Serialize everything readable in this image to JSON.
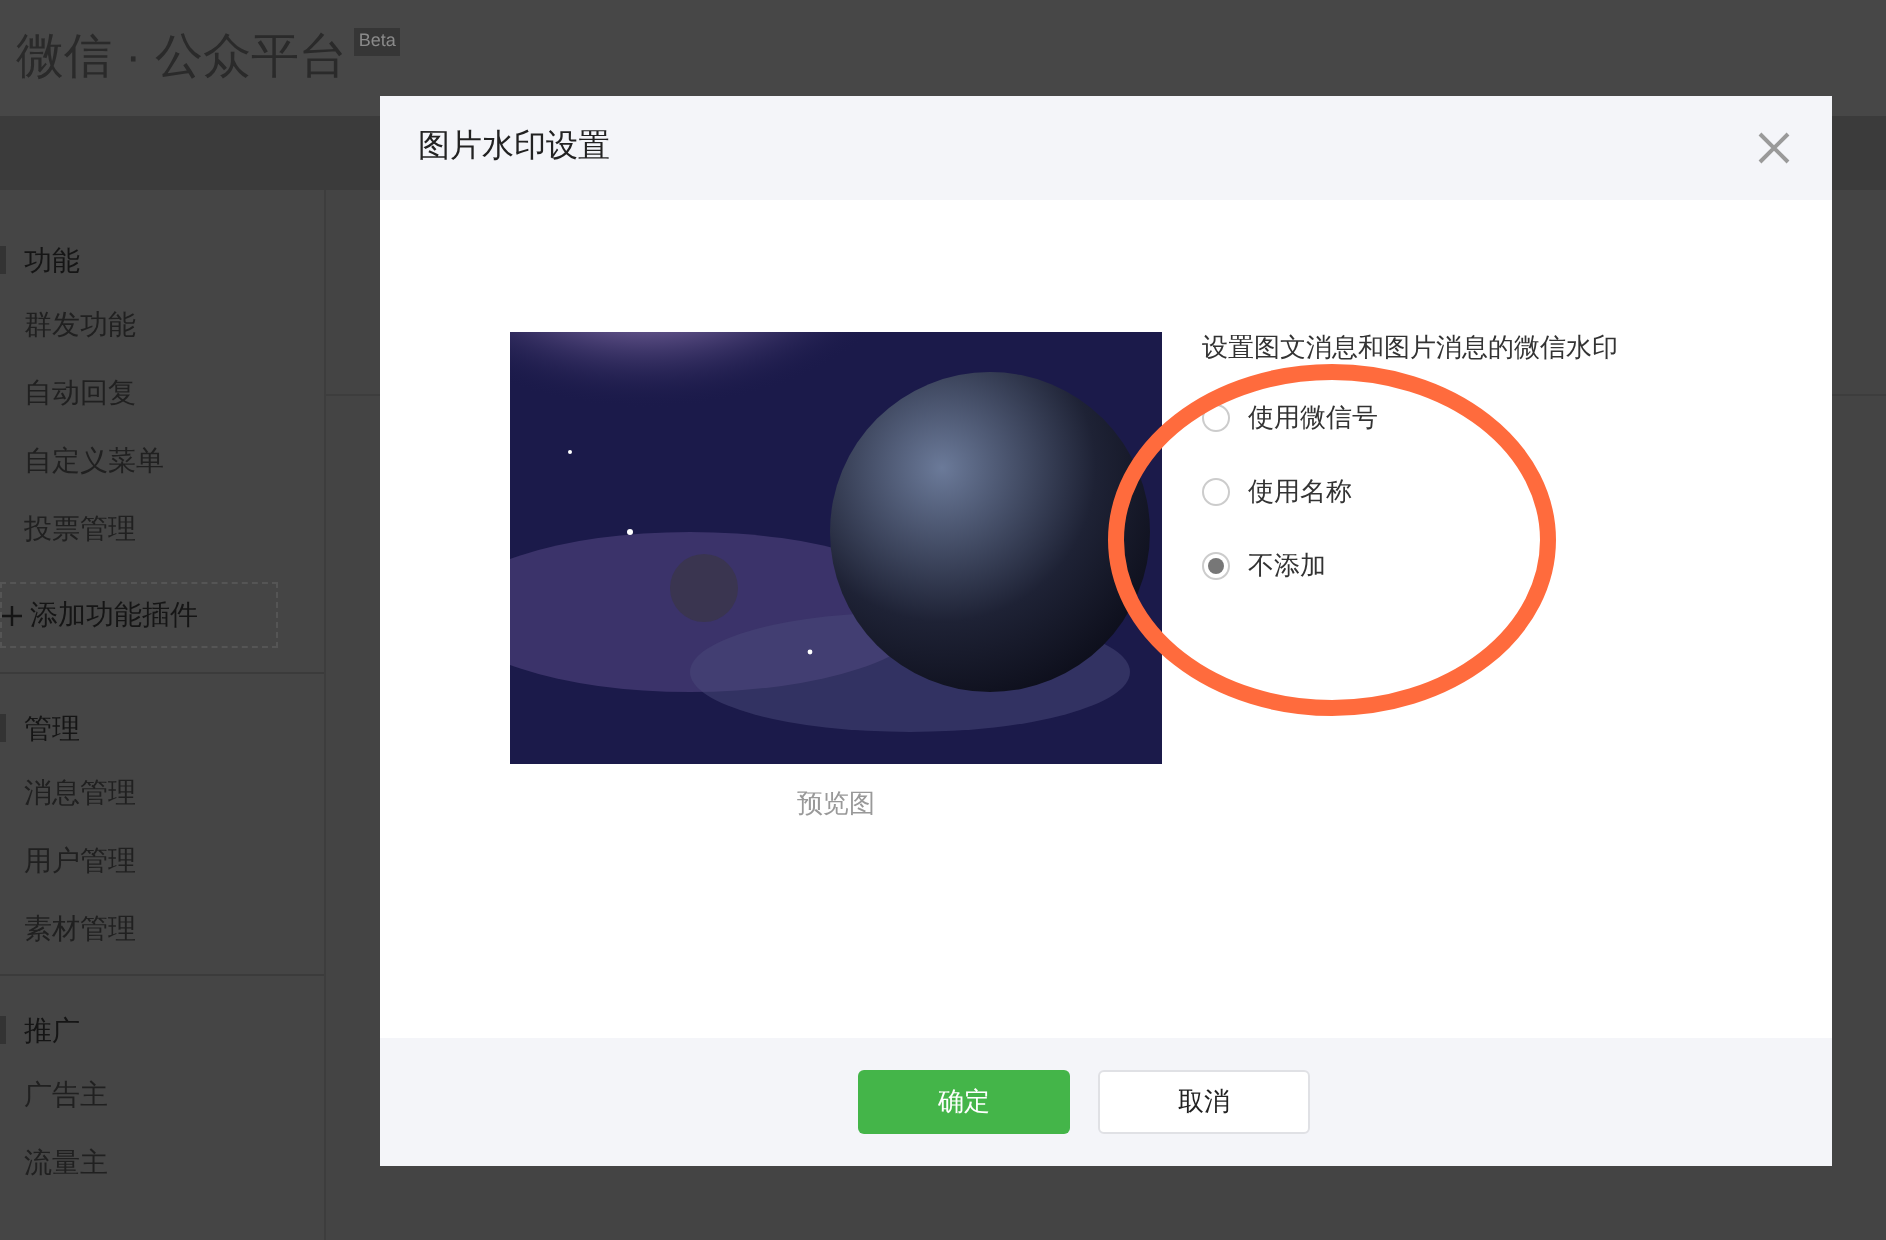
{
  "header": {
    "title": "微信 · 公众平台",
    "badge": "Beta"
  },
  "sidebar": {
    "groups": [
      {
        "label": "功能",
        "items": [
          "群发功能",
          "自动回复",
          "自定义菜单",
          "投票管理"
        ],
        "add_button": "添加功能插件"
      },
      {
        "label": "管理",
        "items": [
          "消息管理",
          "用户管理",
          "素材管理"
        ]
      },
      {
        "label": "推广",
        "items": [
          "广告主",
          "流量主"
        ]
      }
    ]
  },
  "dialog": {
    "title": "图片水印设置",
    "preview": {
      "kind": "picture",
      "caption": "预览图"
    },
    "description": "设置图文消息和图片消息的微信水印",
    "options": [
      {
        "label": "使用微信号",
        "selected": false
      },
      {
        "label": "使用名称",
        "selected": false
      },
      {
        "label": "不添加",
        "selected": true
      }
    ],
    "buttons": [
      {
        "label": "确定",
        "kind": "primary"
      },
      {
        "label": "取消",
        "kind": "default"
      }
    ]
  }
}
